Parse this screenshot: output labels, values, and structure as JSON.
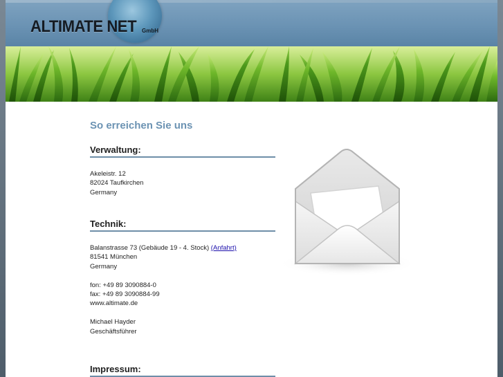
{
  "header": {
    "logo_text": "ALTIMATE NET",
    "logo_sub": "GmbH"
  },
  "main": {
    "title": "So erreichen Sie uns",
    "verwaltung": {
      "heading": "Verwaltung:",
      "street": "Akeleistr. 12",
      "city": "82024 Taufkirchen",
      "country": "Germany"
    },
    "technik": {
      "heading": "Technik:",
      "street": "Balanstrasse 73 (Gebäude 19 - 4. Stock)",
      "directions_link": "(Anfahrt)",
      "city": "81541 München",
      "country": "Germany",
      "phone": "fon: +49 89 3090884-0",
      "fax": "fax: +49 89 3090884-99",
      "web": "www.altimate.de",
      "contact_name": "Michael Hayder",
      "contact_role": "Geschäftsführer"
    },
    "impressum": {
      "heading": "Impressum:"
    }
  },
  "icons": {
    "envelope": "envelope-icon"
  },
  "colors": {
    "header_blue": "#6b93b4",
    "title_blue": "#6c93b3",
    "heading_rule": "#6e8ea8",
    "link": "#1a0dab"
  }
}
